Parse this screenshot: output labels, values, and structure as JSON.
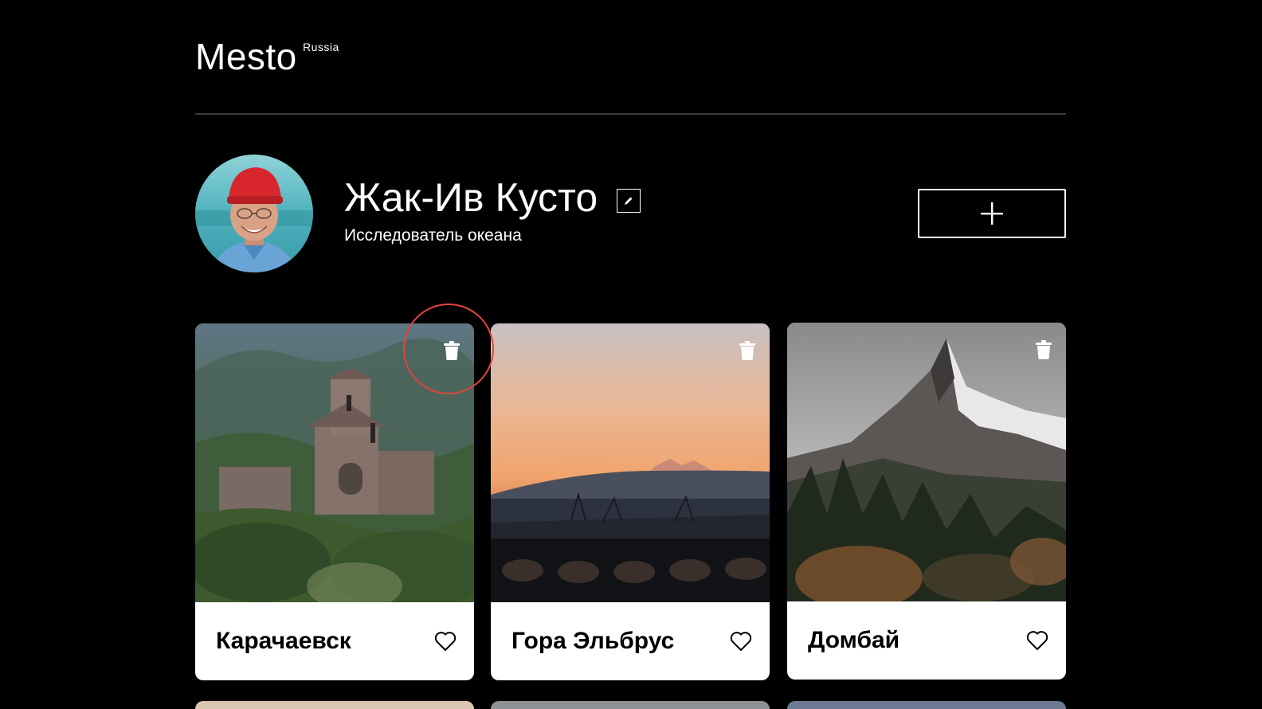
{
  "header": {
    "logo": "Mesto",
    "logo_sup": "Russia"
  },
  "profile": {
    "name": "Жак-Ив Кусто",
    "about": "Исследователь океана",
    "edit_icon": "pencil-icon",
    "add_icon": "plus-icon"
  },
  "cards": [
    {
      "title": "Карачаевск",
      "delete_icon": "trash-icon",
      "like_icon": "heart-icon"
    },
    {
      "title": "Гора Эльбрус",
      "delete_icon": "trash-icon",
      "like_icon": "heart-icon"
    },
    {
      "title": "Домбай",
      "delete_icon": "trash-icon",
      "like_icon": "heart-icon"
    }
  ],
  "colors": {
    "background": "#000000",
    "card": "#ffffff",
    "highlight": "#e2453a"
  }
}
